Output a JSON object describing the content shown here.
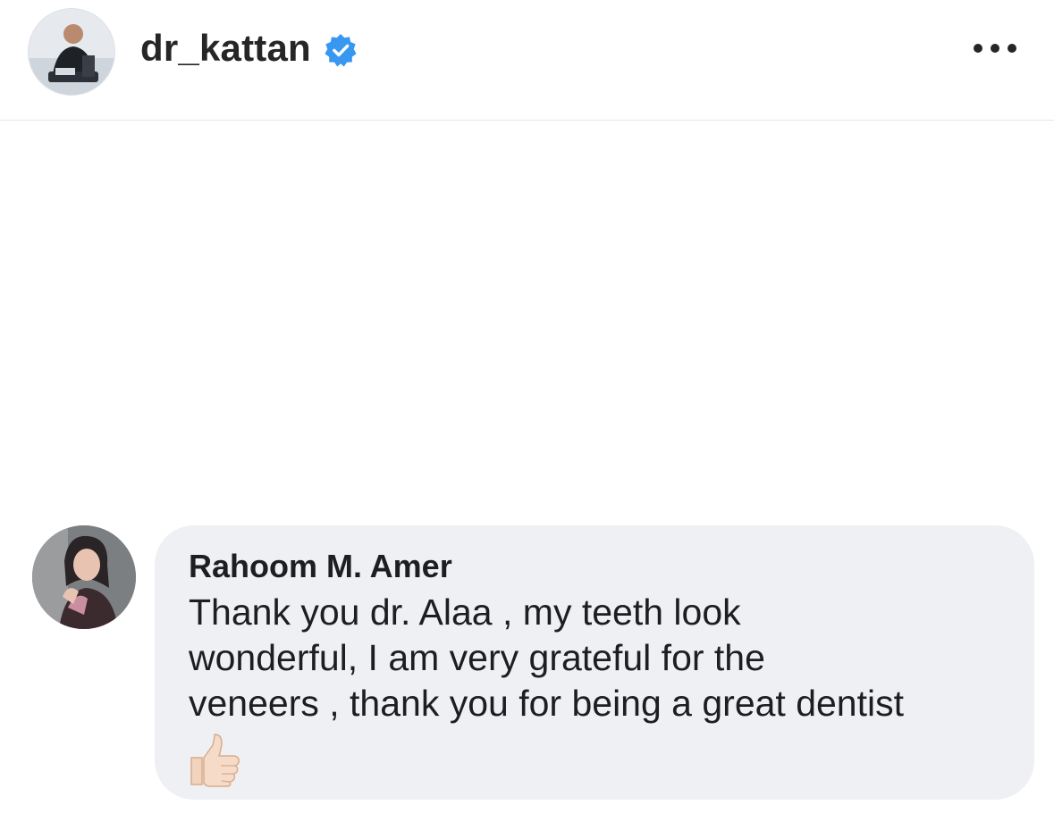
{
  "header": {
    "username": "dr_kattan",
    "verified_icon": "verified-badge-icon",
    "more_icon": "more-options-icon",
    "avatar_icon": "profile-avatar"
  },
  "comment": {
    "author": "Rahoom M. Amer",
    "lines": [
      "Thank you dr. Alaa ,  my teeth look",
      "wonderful, I am very grateful for the",
      "veneers , thank you for being a great dentist"
    ],
    "emoji_icon": "thumbs-up-icon",
    "avatar_icon": "commenter-avatar"
  },
  "colors": {
    "verified_blue": "#3897f0",
    "bubble_bg": "#eff0f3",
    "text_dark": "#1c1e21"
  }
}
